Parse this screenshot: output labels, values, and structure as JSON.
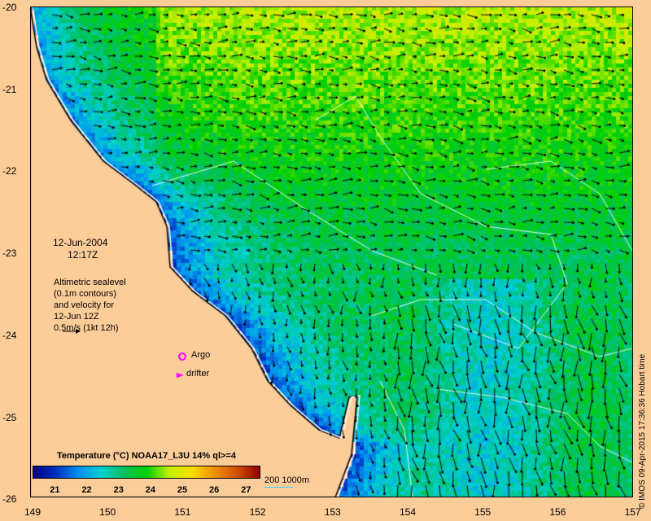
{
  "map": {
    "date": "12-Jun-2004",
    "time": "12:17Z",
    "altimetry_note": [
      "Altimetric sealevel",
      "(0.1m contours)",
      "and velocity for",
      "12-Jun 12Z",
      "0.5m/s (1kt 12h)"
    ],
    "legend_argo": "Argo",
    "legend_drifter": "drifter",
    "argo_color": "#ff00ff",
    "drifter_color": "#ff00ff",
    "land_color": "#fccc99",
    "depth_label": "200  1000m",
    "credit": "© IMOS 09-Apr-2015 17:36:36 Hobart time",
    "lon_ticks": [
      "149",
      "150",
      "151",
      "152",
      "153",
      "154",
      "155",
      "156",
      "157"
    ],
    "lat_ticks": [
      "-20",
      "-21",
      "-22",
      "-23",
      "-24",
      "-25",
      "-26"
    ],
    "colorbar": {
      "title": "Temperature (°C) NOAA17_L3U 14% ql>=4",
      "ticks": [
        "21",
        "22",
        "23",
        "24",
        "25",
        "26",
        "27"
      ],
      "range": [
        20.3,
        27.4
      ]
    }
  }
}
